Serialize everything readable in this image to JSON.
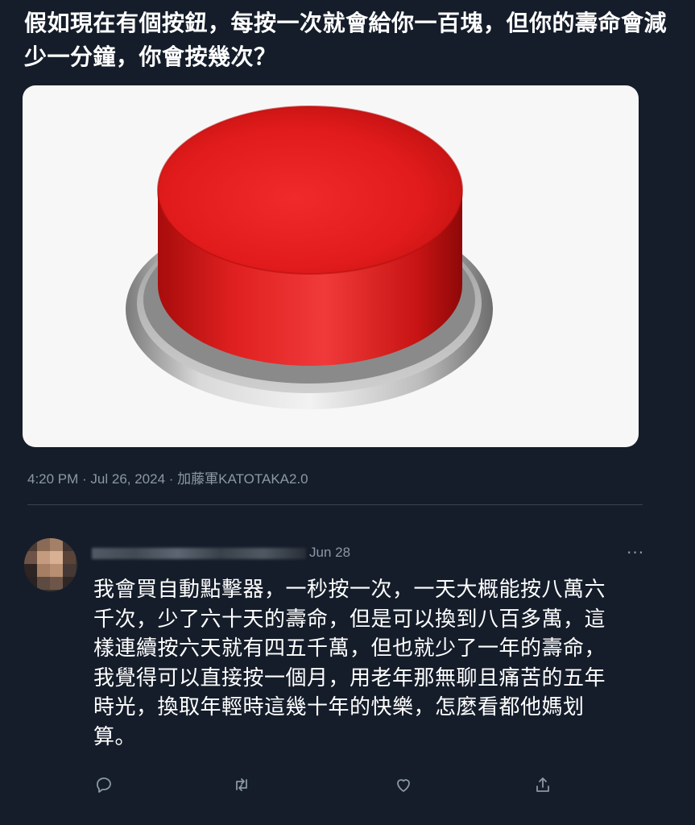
{
  "tweet": {
    "text": "假如現在有個按鈕，每按一次就會給你一百塊，但你的壽命會減少一分鐘，你會按幾次？",
    "meta": "4:20 PM · Jul 26, 2024 · 加藤軍KATOTAKA2.0"
  },
  "reply": {
    "date": "Jun 28",
    "more_label": "···",
    "text": "我會買自動點擊器，一秒按一次，一天大概能按八萬六千次，少了六十天的壽命，但是可以換到八百多萬，這樣連續按六天就有四五千萬，但也就少了一年的壽命，我覺得可以直接按一個月，用老年那無聊且痛苦的五年時光，換取年輕時這幾十年的快樂，怎麼看都他媽划算。"
  },
  "actions": [
    {
      "icon": "reply-icon"
    },
    {
      "icon": "retweet-icon"
    },
    {
      "icon": "like-icon"
    },
    {
      "icon": "share-icon"
    }
  ],
  "colors": {
    "background": "#151d2a",
    "muted_text": "#8b98a5",
    "button_red": "#e11b1b"
  }
}
